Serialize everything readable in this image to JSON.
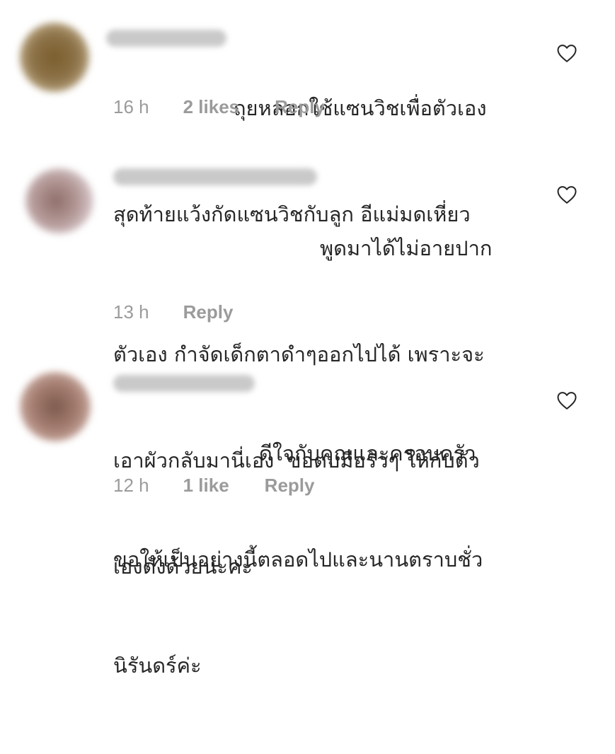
{
  "comments": [
    {
      "lines": [
        "ถุยหลอกใช้แซนวิชเพื่อตัวเอง",
        "สุดท้ายแว้งกัดแซนวิชกับลูก อีแม่มดเหี่ยว"
      ],
      "time": "16 h",
      "likes": "2 likes",
      "reply": "Reply",
      "avatar_color": "#8a6a3a"
    },
    {
      "lines": [
        "พูดมาได้ไม่อายปาก",
        "ตัวเอง กำจัดเด็กตาดำๆออกไปได้ เพราะจะ",
        "เอาผัวกลับมานี่เอง  ขอตบมือรัวๆ ให้กับตัว",
        "เองดังด้วยนะคะ"
      ],
      "time": "13 h",
      "likes": "",
      "reply": "Reply",
      "avatar_color": "#a88c8c"
    },
    {
      "lines": [
        "ดีใจกับคุณและครอบครัว",
        "ขอให้เป็นอย่างนี้ตลอดไปและนานตราบชั่ว",
        "นิรันดร์ค่ะ"
      ],
      "time": "12 h",
      "likes": "1 like",
      "reply": "Reply",
      "avatar_color": "#8c6a60"
    }
  ]
}
